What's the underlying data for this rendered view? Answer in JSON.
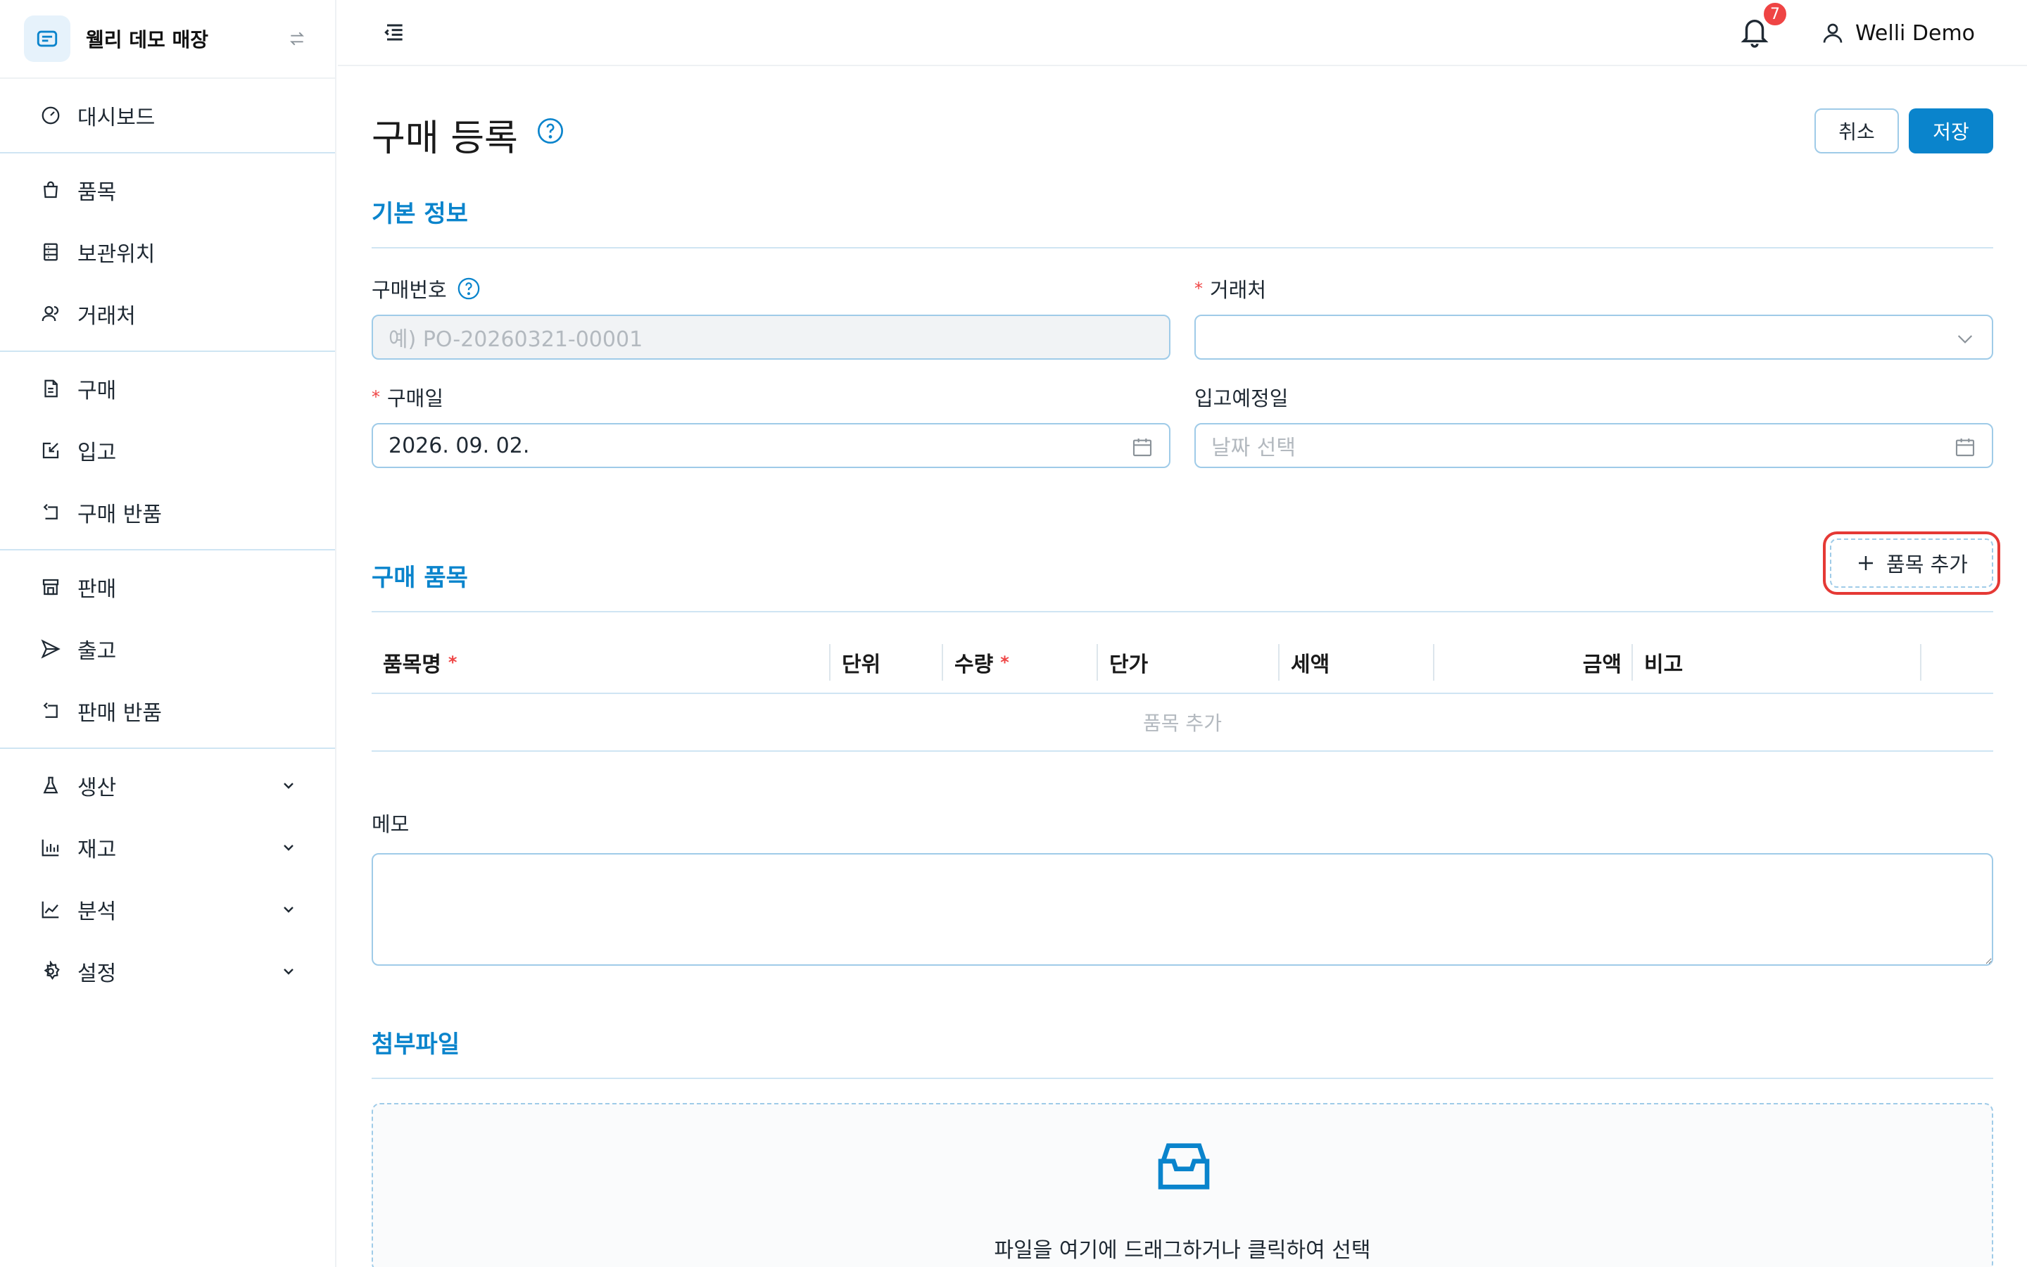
{
  "brand": {
    "name": "웰리 데모 매장"
  },
  "sidebar": {
    "groups": [
      {
        "items": [
          {
            "label": "대시보드",
            "icon": "dashboard-icon"
          }
        ]
      },
      {
        "items": [
          {
            "label": "품목",
            "icon": "shopping-bag-icon"
          },
          {
            "label": "보관위치",
            "icon": "storage-icon"
          },
          {
            "label": "거래처",
            "icon": "partners-icon"
          }
        ]
      },
      {
        "items": [
          {
            "label": "구매",
            "icon": "document-icon"
          },
          {
            "label": "입고",
            "icon": "inbound-icon"
          },
          {
            "label": "구매 반품",
            "icon": "return-icon"
          }
        ]
      },
      {
        "items": [
          {
            "label": "판매",
            "icon": "store-icon"
          },
          {
            "label": "출고",
            "icon": "send-icon"
          },
          {
            "label": "판매 반품",
            "icon": "return-icon"
          }
        ]
      },
      {
        "items": [
          {
            "label": "생산",
            "icon": "flask-icon",
            "expandable": true
          },
          {
            "label": "재고",
            "icon": "bar-chart-icon",
            "expandable": true
          },
          {
            "label": "분석",
            "icon": "line-chart-icon",
            "expandable": true
          },
          {
            "label": "설정",
            "icon": "gear-icon",
            "expandable": true
          }
        ]
      }
    ]
  },
  "header": {
    "notification_count": "7",
    "user_name": "Welli Demo"
  },
  "page": {
    "title": "구매 등록",
    "cancel_label": "취소",
    "save_label": "저장"
  },
  "basic_info": {
    "title": "기본 정보",
    "purchase_no": {
      "label": "구매번호",
      "placeholder": "예) PO-20260321-00001"
    },
    "vendor": {
      "label": "거래처",
      "required": true,
      "value": ""
    },
    "purchase_date": {
      "label": "구매일",
      "required": true,
      "value": "2026. 09. 02."
    },
    "expected_date": {
      "label": "입고예정일",
      "placeholder": "날짜 선택"
    }
  },
  "items_section": {
    "title": "구매 품목",
    "add_label": "품목 추가",
    "columns": [
      {
        "label": "품목명",
        "required": true
      },
      {
        "label": "단위",
        "required": false
      },
      {
        "label": "수량",
        "required": true
      },
      {
        "label": "단가",
        "required": false
      },
      {
        "label": "세액",
        "required": false
      },
      {
        "label": "금액",
        "required": false
      },
      {
        "label": "비고",
        "required": false
      }
    ],
    "empty_text": "품목 추가"
  },
  "memo": {
    "label": "메모",
    "value": ""
  },
  "attachments": {
    "title": "첨부파일",
    "dropzone_text": "파일을 여기에 드래그하거나 클릭하여 선택"
  },
  "colors": {
    "accent": "#0a84cc",
    "border": "#9fcbe8",
    "required": "#ef4444",
    "badge": "#ef4444",
    "highlight": "#e53935"
  }
}
